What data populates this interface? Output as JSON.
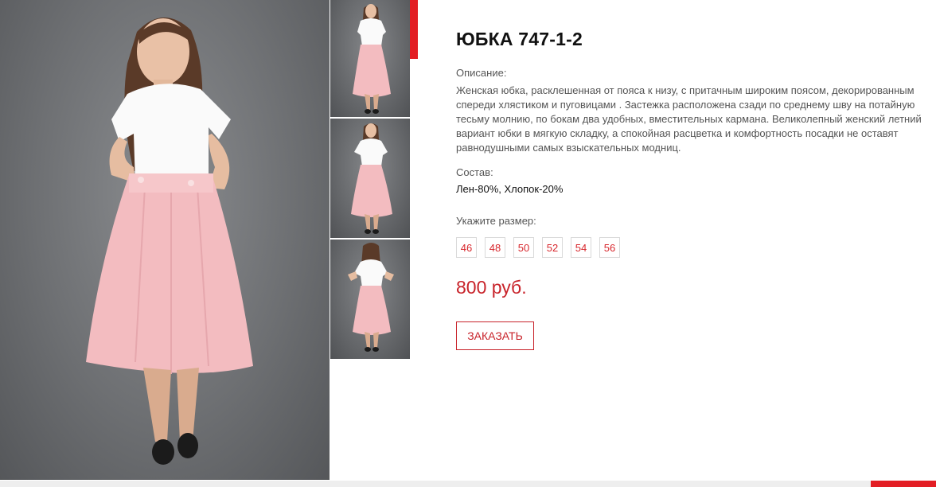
{
  "product": {
    "title": "ЮБКА 747-1-2",
    "description_label": "Описание:",
    "description": "Женская юбка, расклешенная от пояса к низу, с притачным широким поясом, декорированным спереди хлястиком и пуговицами . Застежка расположена сзади по среднему шву на потайную тесьму молнию, по бокам два удобных, вместительных кармана. Великолепный женский летний вариант юбки в мягкую складку, а спокойная расцветка и комфортность посадки не оставят равнодушными самых взыскательных модниц.",
    "composition_label": "Состав:",
    "composition": "Лен-80%, Хлопок-20%",
    "size_label": "Укажите размер:",
    "sizes": [
      "46",
      "48",
      "50",
      "52",
      "54",
      "56"
    ],
    "price": "800 руб.",
    "order_button": "ЗАКАЗАТЬ"
  },
  "colors": {
    "accent": "#e31e24",
    "price": "#c8232a",
    "skirt": "#f2b9bd",
    "background_photo": "#6e7073"
  },
  "icons": {
    "main_photo": "model-photo-front",
    "thumbnails": [
      "model-photo-front",
      "model-photo-front",
      "model-photo-back"
    ]
  }
}
